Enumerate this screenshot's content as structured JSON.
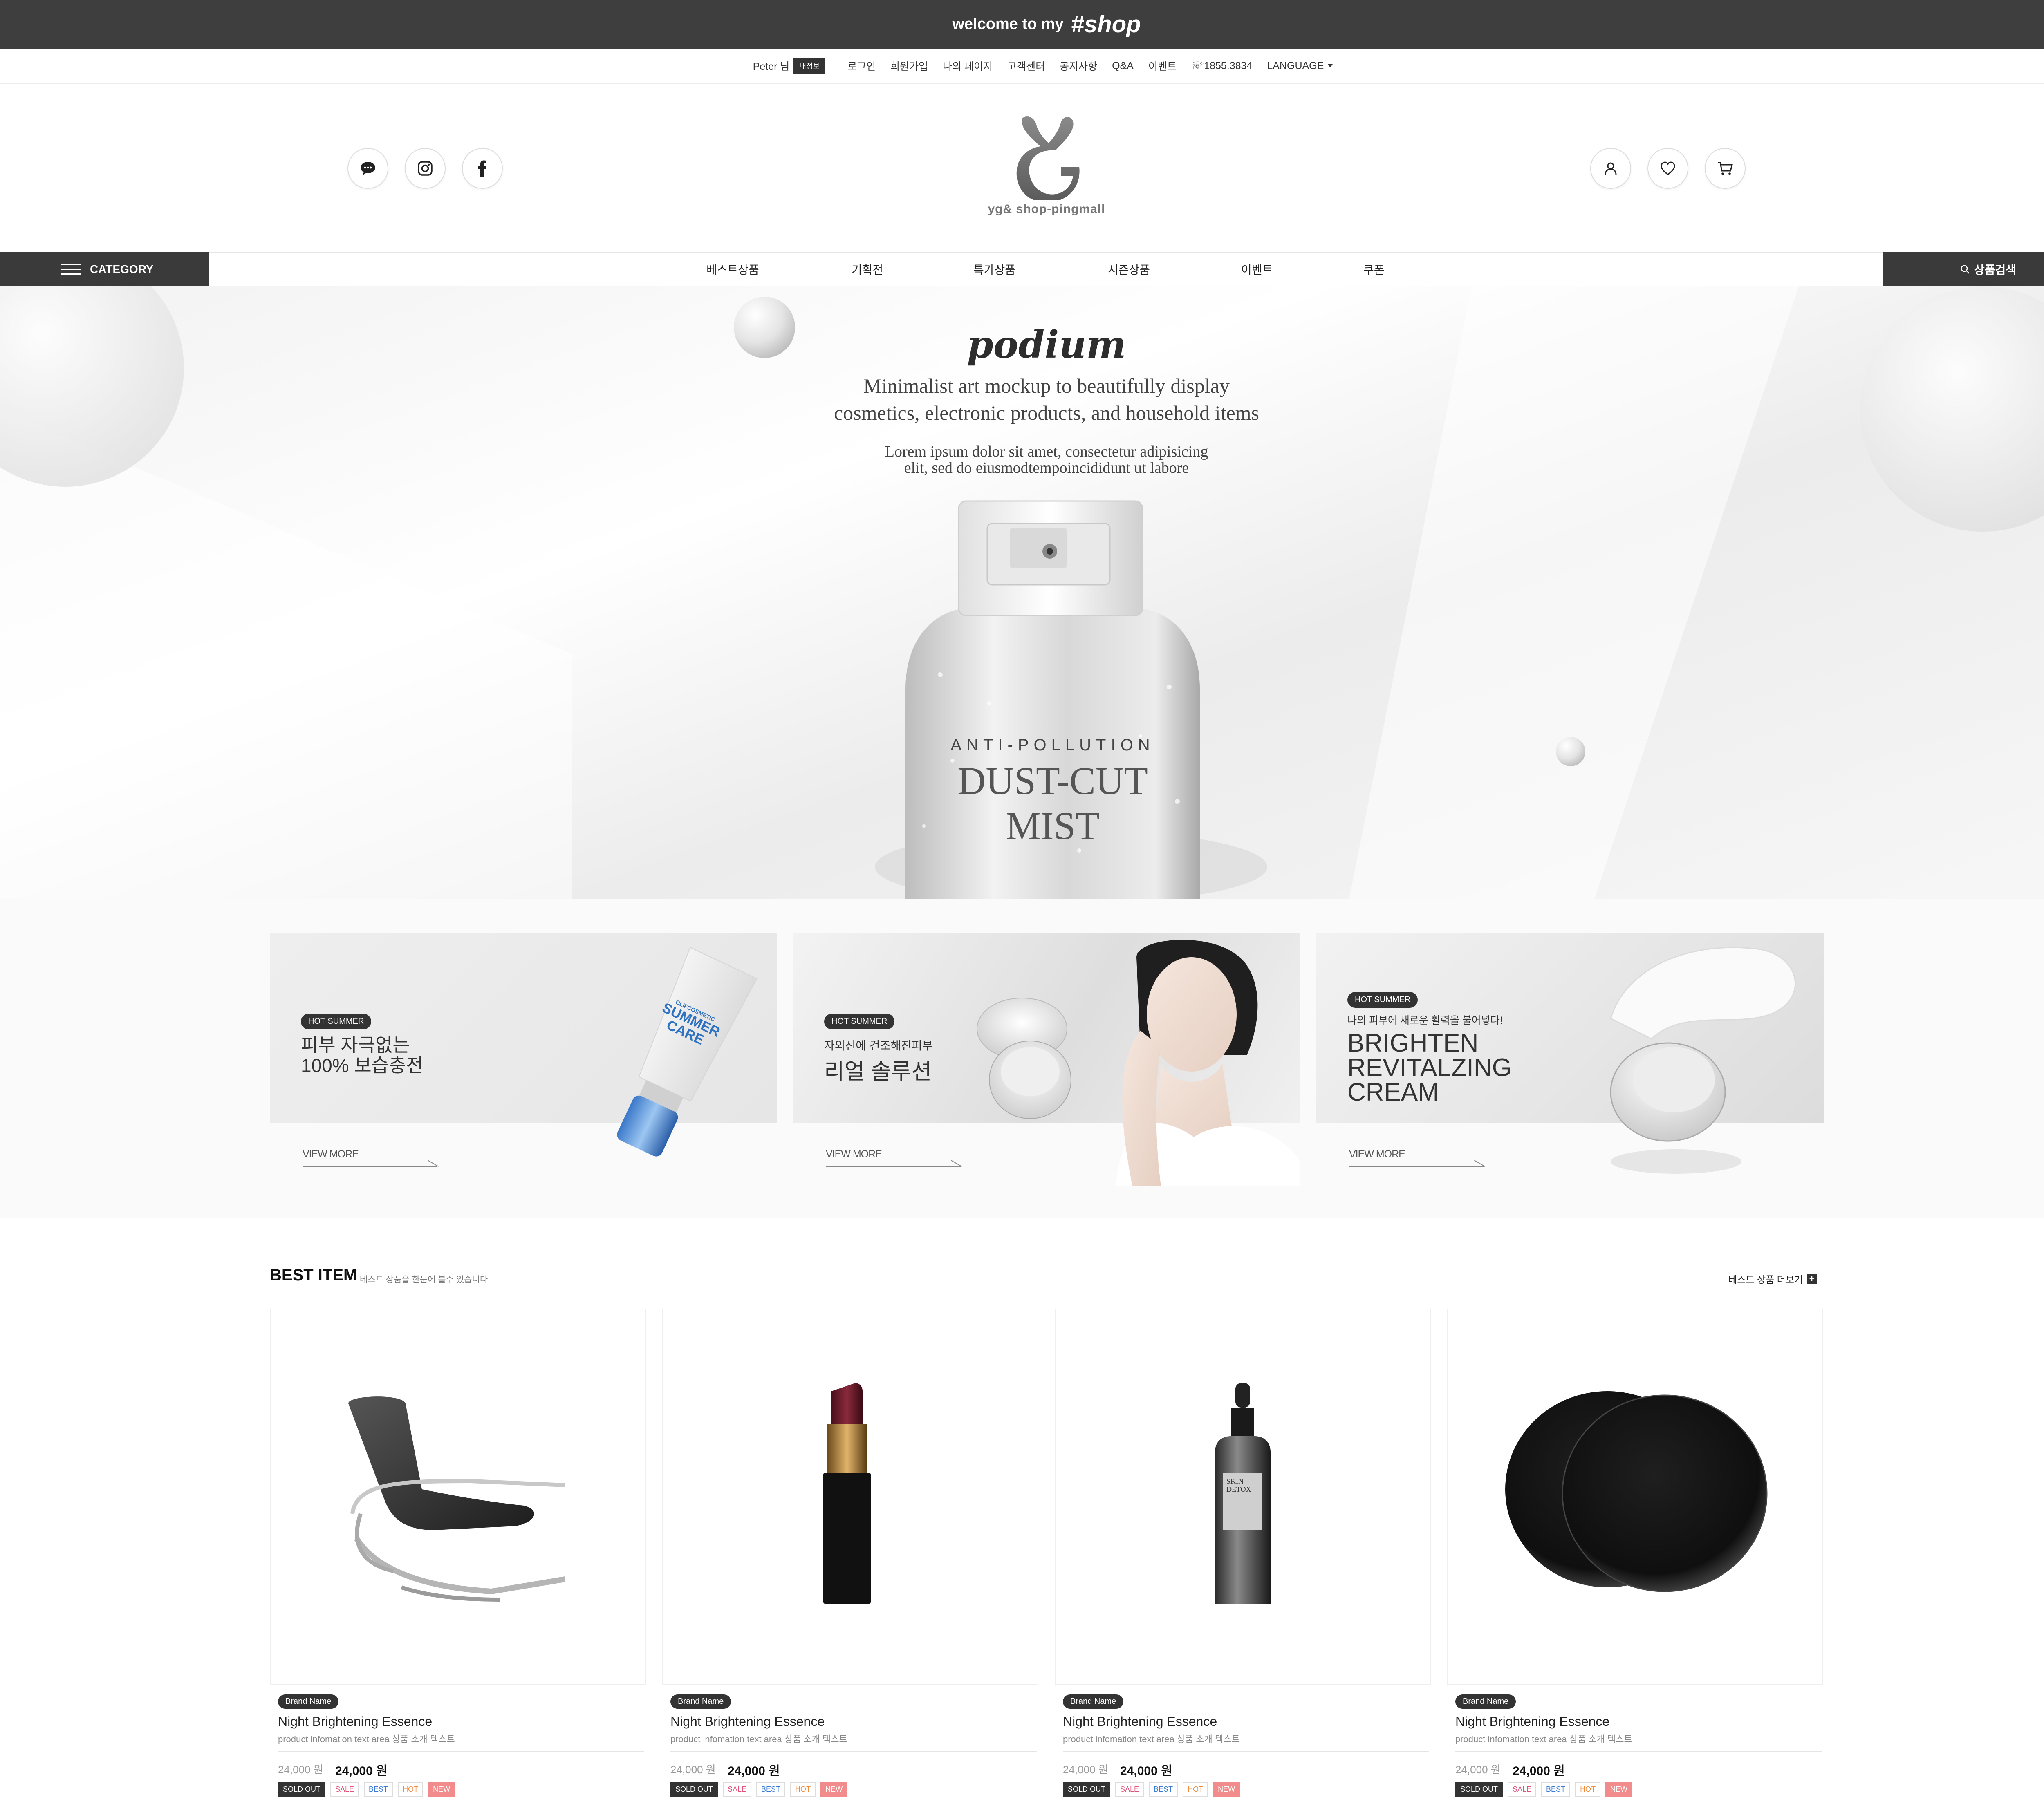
{
  "promo": {
    "welcome": "welcome to my",
    "shop": "#shop"
  },
  "util": {
    "user": "Peter 님",
    "my_info": "내정보",
    "links": [
      "로그인",
      "회원가입",
      "나의 페이지",
      "고객센터",
      "공지사항",
      "Q&A",
      "이벤트"
    ],
    "phone": "☏1855.3834",
    "language": "LANGUAGE"
  },
  "header": {
    "logo_text": "yg& shop-pingmall",
    "social_icons": [
      "talk-icon",
      "instagram-icon",
      "facebook-icon"
    ],
    "user_icons": [
      "user-icon",
      "heart-icon",
      "cart-icon"
    ]
  },
  "nav": {
    "category": "CATEGORY",
    "items": [
      "베스트상품",
      "기획전",
      "특가상품",
      "시즌상품",
      "이벤트",
      "쿠폰"
    ],
    "search": "상품검색"
  },
  "hero": {
    "title": "podium",
    "subtitle1": "Minimalist art mockup to beautifully display",
    "subtitle2": "cosmetics, electronic products, and household items",
    "desc1": "Lorem ipsum dolor sit amet, consectetur adipisicing",
    "desc2": "elit, sed do eiusmodtempoincididunt ut labore",
    "product_line1": "ANTI-POLLUTION",
    "product_line2": "DUST-CUT",
    "product_line3": "MIST"
  },
  "banners": [
    {
      "badge": "HOT SUMMER",
      "line1": "피부 자극없는",
      "line2": "100% 보습충전",
      "more": "VIEW MORE",
      "tube_brand": "CLIFCOSMETIC",
      "tube_title1": "SUMMER",
      "tube_title2": "CARE"
    },
    {
      "badge": "HOT SUMMER",
      "line1": "자외선에 건조해진피부",
      "line2": "리얼 솔루션",
      "more": "VIEW MORE"
    },
    {
      "badge": "HOT SUMMER",
      "line1": "나의 피부에 새로운 활력을 불어넣다!",
      "line2": "BRIGHTEN",
      "line3": "REVITALZING",
      "line4": "CREAM",
      "more": "VIEW MORE"
    }
  ],
  "best": {
    "title": "BEST ITEM",
    "subtitle": "베스트 상품을 한눈에 볼수 있습니다.",
    "more": "베스트 상품 더보기",
    "products": [
      {
        "image": "rocking-chair",
        "brand": "Brand Name",
        "name": "Night Brightening Essence",
        "desc": "product infomation text area 상품 소개 텍스트",
        "old_price": "24,000 원",
        "price": "24,000 원",
        "tags": [
          "SOLD OUT",
          "SALE",
          "BEST",
          "HOT",
          "NEW"
        ]
      },
      {
        "image": "lipstick",
        "brand": "Brand Name",
        "name": "Night Brightening Essence",
        "desc": "product infomation text area 상품 소개 텍스트",
        "old_price": "24,000 원",
        "price": "24,000 원",
        "tags": [
          "SOLD OUT",
          "SALE",
          "BEST",
          "HOT",
          "NEW"
        ]
      },
      {
        "image": "serum-bottle",
        "brand": "Brand Name",
        "name": "Night Brightening Essence",
        "desc": "product infomation text area 상품 소개 텍스트",
        "old_price": "24,000 원",
        "price": "24,000 원",
        "tags": [
          "SOLD OUT",
          "SALE",
          "BEST",
          "HOT",
          "NEW"
        ],
        "bottle_label1": "SKIN",
        "bottle_label2": "DETOX"
      },
      {
        "image": "black-plates",
        "brand": "Brand Name",
        "name": "Night Brightening Essence",
        "desc": "product infomation text area 상품 소개 텍스트",
        "old_price": "24,000 원",
        "price": "24,000 원",
        "tags": [
          "SOLD OUT",
          "SALE",
          "BEST",
          "HOT",
          "NEW"
        ]
      }
    ]
  },
  "colors": {
    "dark": "#3a3a3a",
    "sale": "#e0527a",
    "best": "#3a7bd5",
    "hot": "#f08a3c",
    "new": "#f28b8b"
  }
}
